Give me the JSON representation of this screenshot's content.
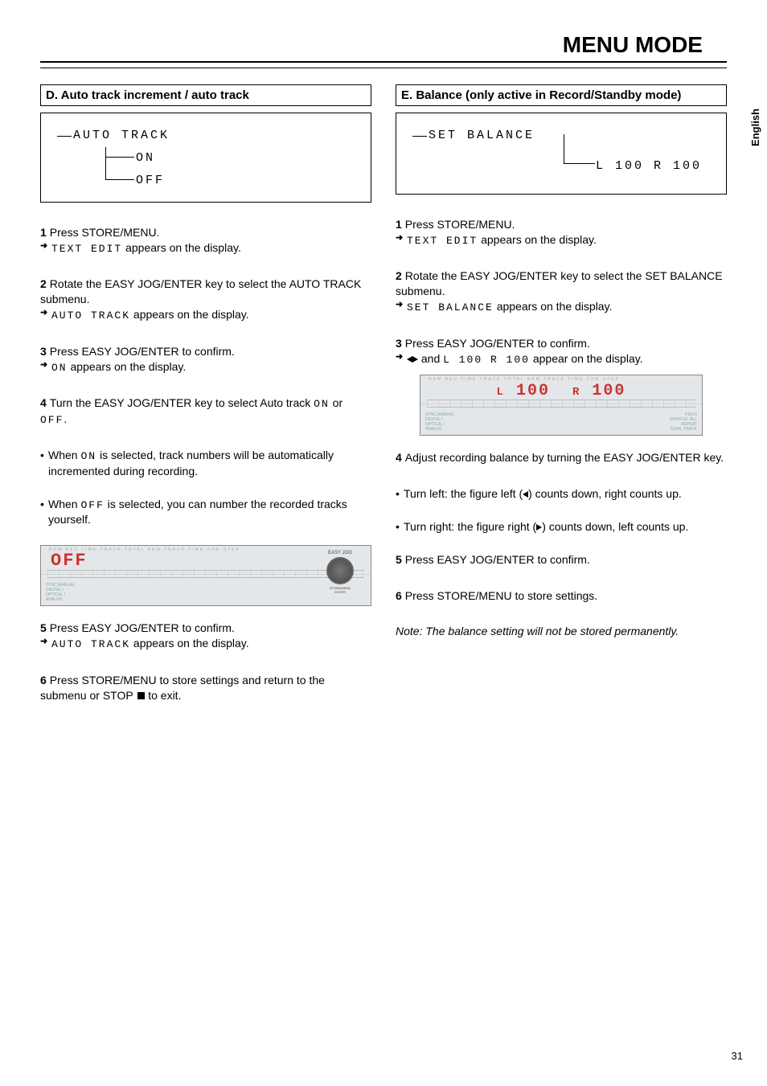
{
  "page_title": "MENU MODE",
  "side_tab": "English",
  "page_number": "31",
  "left": {
    "header": "D. Auto track increment / auto track",
    "lcd": {
      "root": "AUTO TRACK",
      "on": "ON",
      "off": "OFF"
    },
    "steps": {
      "1": {
        "main": "Press STORE/MENU.",
        "sub_prefix": "",
        "sub_code": "TEXT EDIT",
        "sub_suffix": " appears on the display."
      },
      "2": {
        "main": "Rotate the EASY JOG/ENTER key to select the AUTO TRACK submenu.",
        "sub_code": "AUTO TRACK",
        "sub_suffix": " appears on the display."
      },
      "3": {
        "main": "Press EASY JOG/ENTER to confirm.",
        "sub_code": "ON",
        "sub_suffix": " appears on the display."
      },
      "4": {
        "prefix": "Turn the EASY JOG/ENTER key to select Auto track ",
        "code1": "ON",
        "mid": " or ",
        "code2": "OFF",
        "suffix": "."
      },
      "b1": {
        "prefix": "When ",
        "code": "ON",
        "suffix": " is selected, track numbers will be automatically incremented during recording."
      },
      "b2": {
        "prefix": "When ",
        "code": "OFF",
        "suffix": " is selected, you can number the recorded tracks yourself."
      },
      "5": {
        "main": "Press EASY JOG/ENTER to confirm.",
        "sub_code": "AUTO TRACK",
        "sub_suffix": " appears on the display."
      },
      "6": {
        "prefix": "Press STORE/MENU to store settings and return to the submenu or STOP ",
        "suffix": " to exit."
      }
    },
    "diagram": {
      "seg": "OFF",
      "top_labels": "REM  REC  TIME TRACK        TOTAL  REM  TRACK  TIME            CHR   STEP",
      "jog_label": "EASY JOG",
      "jog_store": "STORE/MENU",
      "jog_enter": "ENTER",
      "left_labels": "SYNC MANUAL\nDIGITAL I\nOPTICAL I\nANALOG"
    }
  },
  "right": {
    "header": "E. Balance (only active in Record/Standby mode)",
    "lcd": {
      "root": "SET BALANCE",
      "leaf": "L 100 R 100"
    },
    "steps": {
      "1": {
        "main": "Press STORE/MENU.",
        "sub_code": "TEXT EDIT",
        "sub_suffix": " appears on the display."
      },
      "2": {
        "main": "Rotate the EASY JOG/ENTER key to select the SET BALANCE submenu.",
        "sub_code": "SET BALANCE",
        "sub_suffix": " appears on the display."
      },
      "3": {
        "main": "Press EASY JOG/ENTER to confirm.",
        "sub_prefix": "",
        "sub_mid": " and ",
        "sub_code": "L 100  R 100",
        "sub_suffix": " appear on the display."
      },
      "4": {
        "main": "Adjust recording balance by turning the EASY JOG/ENTER key."
      },
      "b1": {
        "prefix": "Turn left: the figure left (",
        "suffix": ") counts down, right counts up."
      },
      "b2": {
        "prefix": "Turn right: the figure right (",
        "suffix": ") counts down, left counts up."
      },
      "5": {
        "main": "Press EASY JOG/ENTER to confirm."
      },
      "6": {
        "main": "Press STORE/MENU to store settings."
      }
    },
    "note": "Note: The balance setting will not be stored permanently.",
    "diagram": {
      "l": "L",
      "r": "R",
      "val": "100",
      "top_labels": "REM  REC  TIME TRACK        TOTAL  REM  TRACK  TIME            CHR   STEP",
      "left_labels": "SYNC MANUAL\nDIGITAL I\nOPTICAL I\nANALOG",
      "right_labels": "PROG\nSHUFFLE  ALL\nREPEAT\nSCAN  TRACK"
    }
  }
}
